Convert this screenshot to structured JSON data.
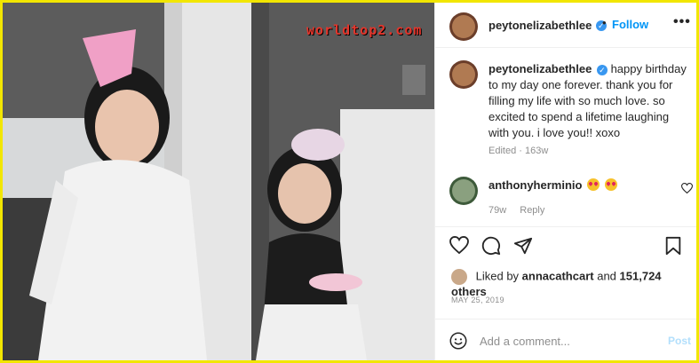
{
  "watermark": "worldtop2.com",
  "post": {
    "username": "peytonelizabethlee",
    "follow_label": "Follow",
    "separator": "•",
    "more_label": "•••",
    "caption": "happy birthday to my day one forever. thank you for filling my life with so much love. so excited to spend a lifetime laughing with you. i love you!! xoxo",
    "edited_label": "Edited",
    "meta_separator": "·",
    "age": "163w"
  },
  "comment": {
    "username": "anthonyherminio",
    "age": "79w",
    "reply_label": "Reply"
  },
  "likes": {
    "prefix": "Liked by",
    "user": "annacathcart",
    "and": "and",
    "count": "151,724 others"
  },
  "date": "MAY 25, 2019",
  "composer": {
    "placeholder": "Add a comment...",
    "post_label": "Post"
  },
  "colors": {
    "accent": "#0095f6",
    "frame": "#f2e600",
    "verified": "#3897f0"
  },
  "icons": [
    "verified-icon",
    "heart-icon",
    "comment-icon",
    "share-icon",
    "bookmark-icon",
    "smile-icon"
  ]
}
